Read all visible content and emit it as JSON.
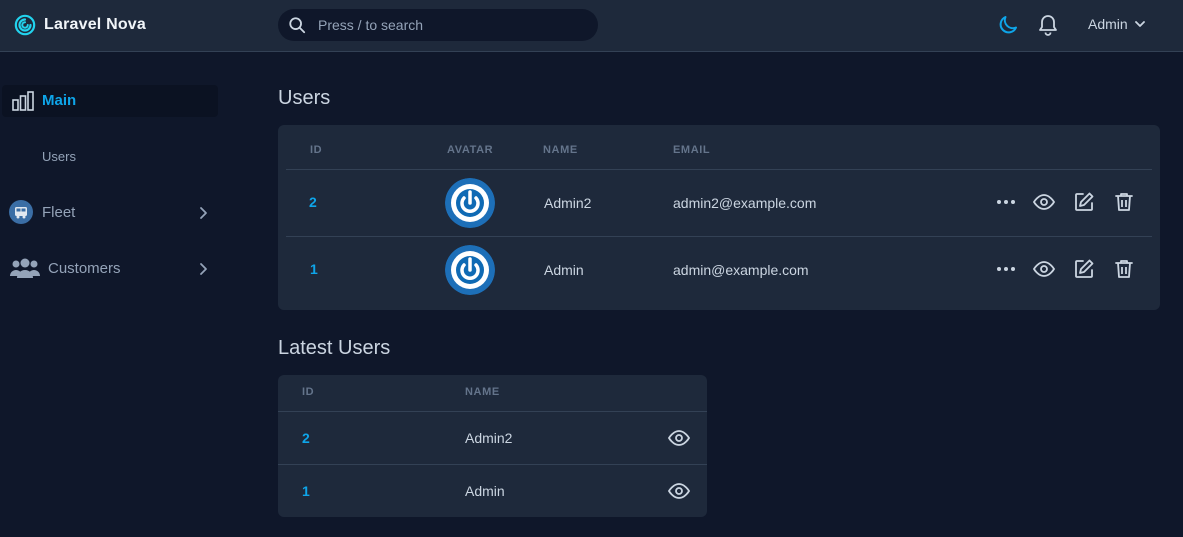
{
  "app": {
    "brand": "Laravel Nova"
  },
  "search": {
    "placeholder": "Press / to search"
  },
  "header": {
    "user_label": "Admin"
  },
  "sidebar": {
    "main": {
      "label": "Main",
      "items": [
        {
          "label": "Users"
        }
      ]
    },
    "groups": [
      {
        "label": "Fleet",
        "icon": "bus-icon"
      },
      {
        "label": "Customers",
        "icon": "users-icon"
      }
    ]
  },
  "users_card": {
    "title": "Users",
    "columns": [
      "ID",
      "AVATAR",
      "NAME",
      "EMAIL"
    ],
    "rows": [
      {
        "id": "2",
        "name": "Admin2",
        "email": "admin2@example.com"
      },
      {
        "id": "1",
        "name": "Admin",
        "email": "admin@example.com"
      }
    ]
  },
  "latest_users_card": {
    "title": "Latest Users",
    "columns": [
      "ID",
      "NAME"
    ],
    "rows": [
      {
        "id": "2",
        "name": "Admin2"
      },
      {
        "id": "1",
        "name": "Admin"
      }
    ]
  },
  "colors": {
    "accent": "#0ea5e9",
    "background": "#0f172a",
    "surface": "#1e293b"
  }
}
